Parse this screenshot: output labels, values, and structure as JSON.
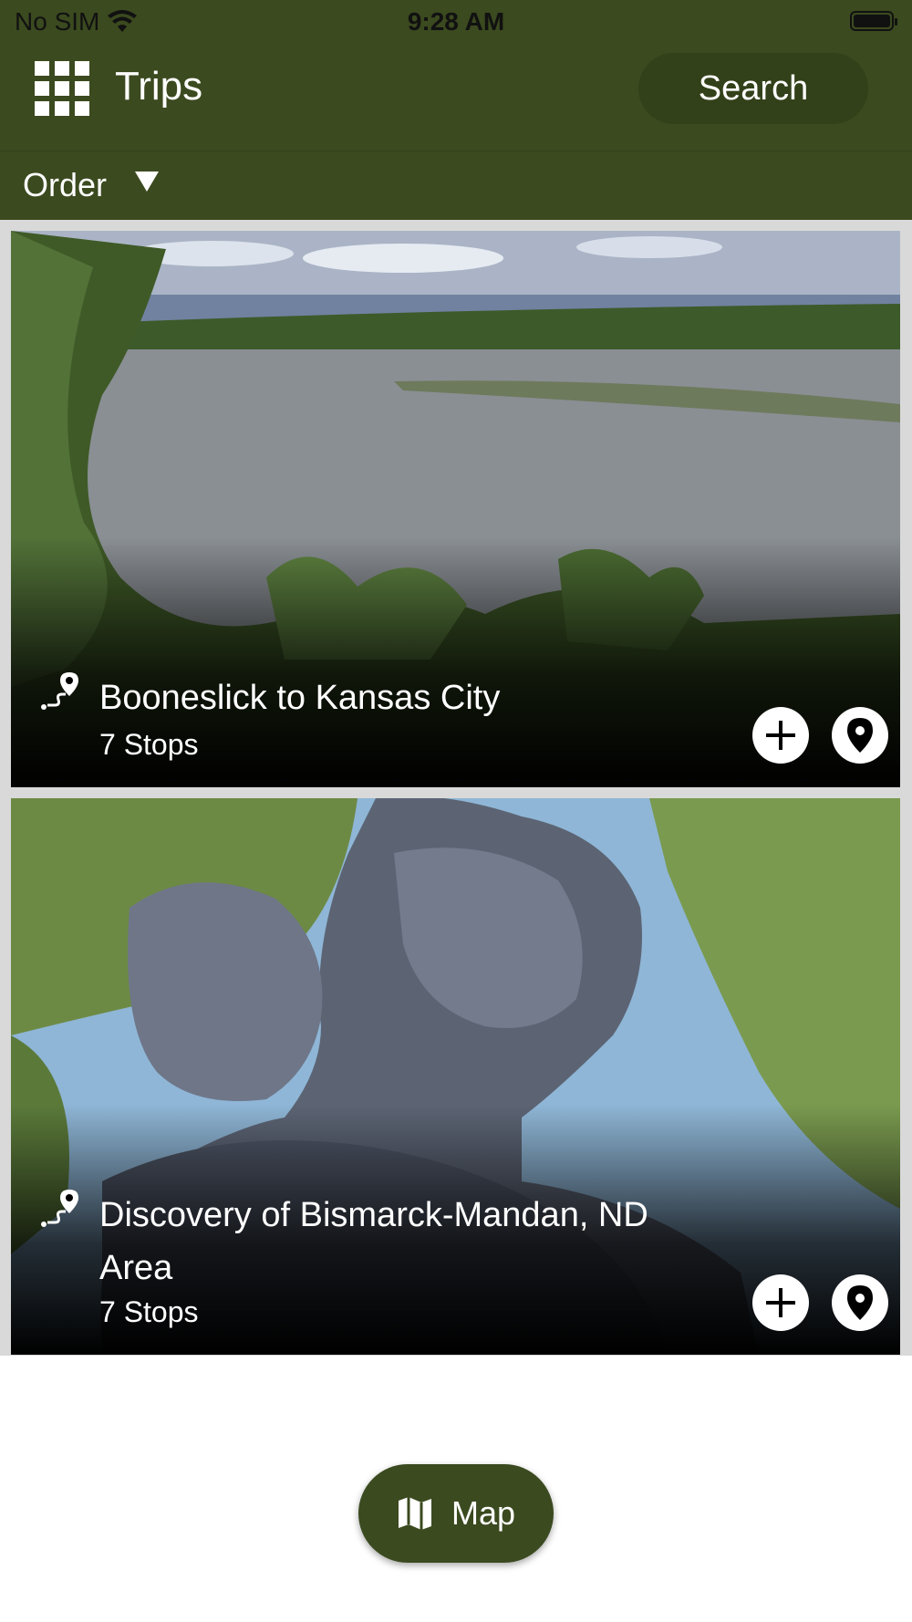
{
  "status_bar": {
    "carrier": "No SIM",
    "time": "9:28 AM",
    "wifi_icon": "wifi-icon",
    "battery_icon": "battery-icon"
  },
  "header": {
    "menu_icon": "grid-icon",
    "title": "Trips",
    "search_label": "Search"
  },
  "sort": {
    "label": "Order",
    "icon": "caret-down-icon"
  },
  "trips": [
    {
      "title": "Booneslick to Kansas City",
      "stops": "7 Stops",
      "image": "river-landscape"
    },
    {
      "title": "Discovery of Bismarck-Mandan, ND Area",
      "stops": "7 Stops",
      "image": "statue-mother-child"
    }
  ],
  "footer": {
    "map_label": "Map",
    "map_icon": "map-icon"
  },
  "colors": {
    "brand": "#3b4a1f",
    "brand_dark": "#33411a"
  }
}
